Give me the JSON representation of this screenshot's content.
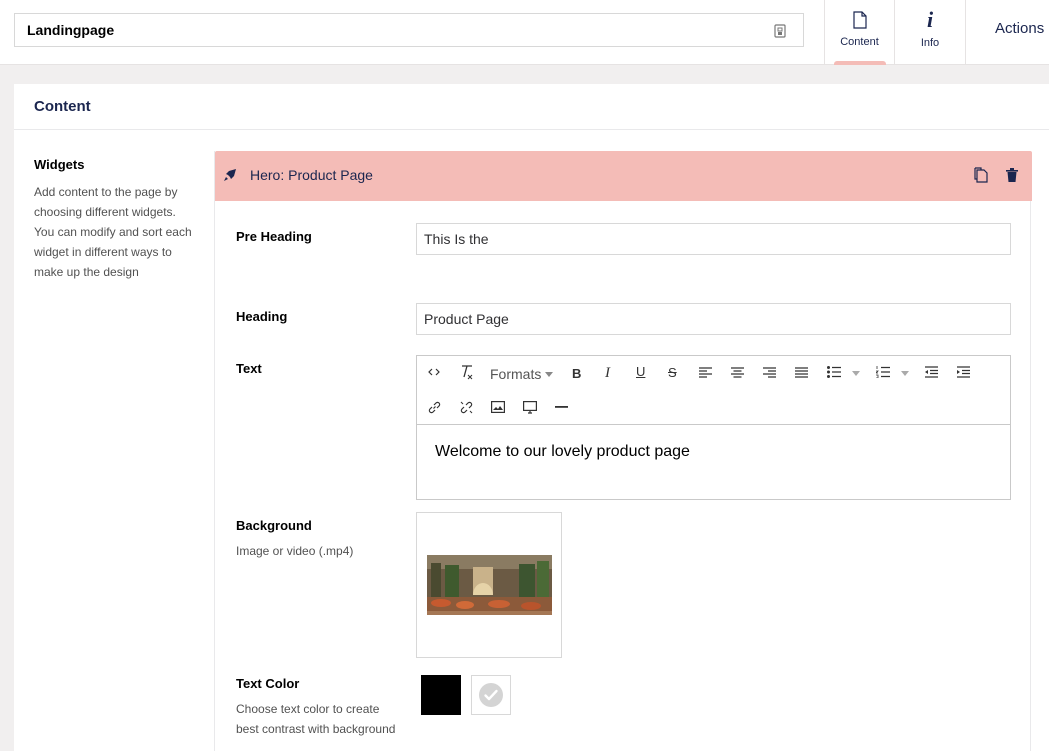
{
  "header": {
    "name_value": "Landingpage",
    "tabs": [
      {
        "label": "Content",
        "icon": "document-icon",
        "active": true
      },
      {
        "label": "Info",
        "icon": "info-icon",
        "active": false
      }
    ],
    "actions_label": "Actions",
    "info_glyph": "i"
  },
  "panel": {
    "title": "Content",
    "property": {
      "title": "Widgets",
      "description": "Add content to the page by choosing different widgets. You can modify and sort each widget in different ways to make up the design"
    }
  },
  "widget": {
    "title": "Hero: Product Page",
    "fields": {
      "pre_heading": {
        "label": "Pre Heading",
        "value": "This Is the"
      },
      "heading": {
        "label": "Heading",
        "value": "Product Page"
      },
      "text": {
        "label": "Text",
        "formats_label": "Formats",
        "content": "Welcome to our lovely product page"
      },
      "background": {
        "label": "Background",
        "description": "Image or video (.mp4)"
      },
      "text_color": {
        "label": "Text Color",
        "description": "Choose text color to create best contrast with background",
        "options": [
          "#000000",
          "#ffffff"
        ]
      }
    }
  },
  "colors": {
    "accent": "#f4bcb7",
    "navy": "#1b264f",
    "page_bg": "#f1efef"
  }
}
